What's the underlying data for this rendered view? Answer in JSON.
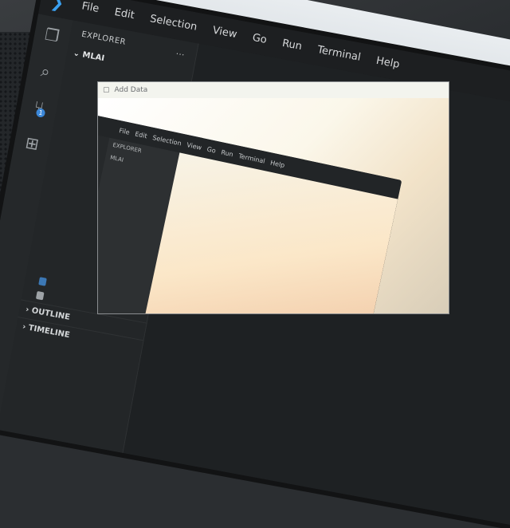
{
  "app": {
    "menu": [
      "File",
      "Edit",
      "Selection",
      "View",
      "Go",
      "Run",
      "Terminal",
      "Help"
    ]
  },
  "activity_bar": {
    "icons": [
      "explorer-icon",
      "search-icon",
      "source-control-icon",
      "extensions-icon"
    ],
    "badge": "1"
  },
  "sidebar": {
    "title": "EXPLORER",
    "more": "...",
    "folder": "MLAI",
    "panels": [
      "OUTLINE",
      "TIMELINE"
    ]
  },
  "dialog": {
    "title": "Add Data"
  },
  "nested_window": {
    "menu": [
      "File",
      "Edit",
      "Selection",
      "View",
      "Go",
      "Run",
      "Terminal",
      "Help"
    ],
    "explorer": "EXPLORER",
    "folder": "MLAI"
  },
  "colors": {
    "accent": "#3aa0f0",
    "titlebar": "#1d1f21",
    "sidebar": "#232628"
  }
}
